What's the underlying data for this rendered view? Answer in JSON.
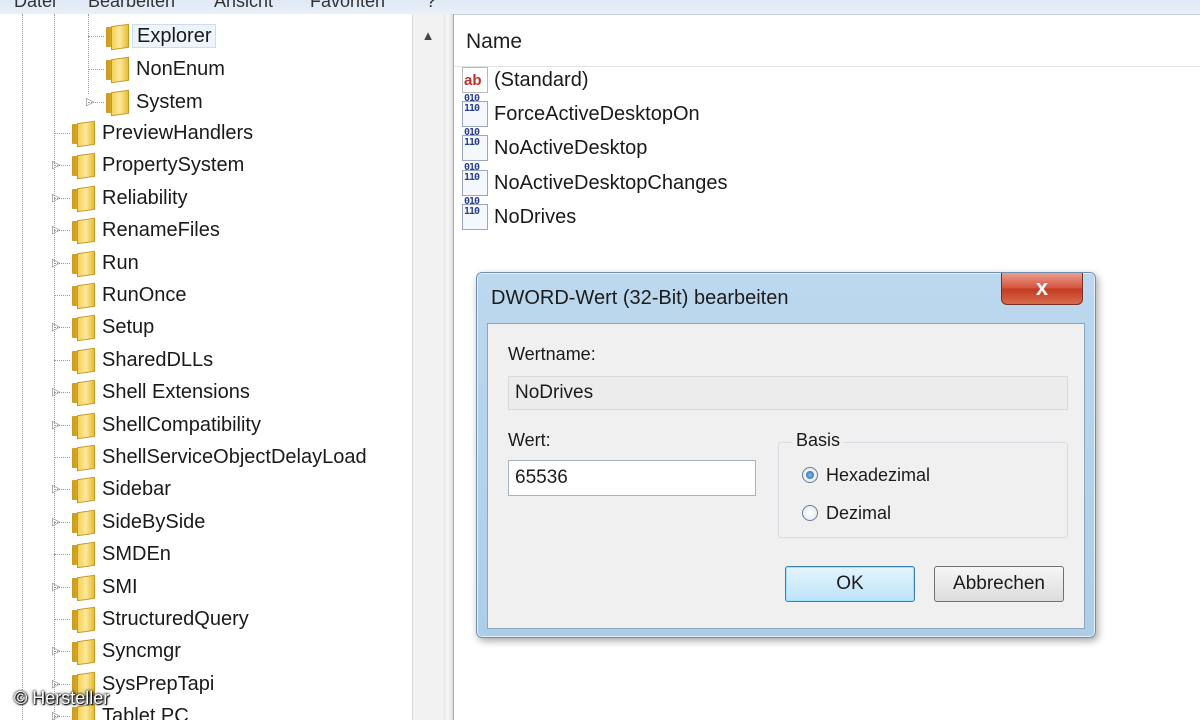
{
  "menubar": {
    "items": [
      "Datei",
      "Bearbeiten",
      "Ansicht",
      "Favoriten",
      "?"
    ]
  },
  "tree": {
    "child_items": [
      {
        "label": "Explorer",
        "selected": true,
        "expandable": false
      },
      {
        "label": "NonEnum",
        "expandable": false
      },
      {
        "label": "System",
        "expandable": true
      }
    ],
    "items": [
      {
        "label": "PreviewHandlers",
        "expandable": false
      },
      {
        "label": "PropertySystem",
        "expandable": true
      },
      {
        "label": "Reliability",
        "expandable": true
      },
      {
        "label": "RenameFiles",
        "expandable": true
      },
      {
        "label": "Run",
        "expandable": true
      },
      {
        "label": "RunOnce",
        "expandable": false
      },
      {
        "label": "Setup",
        "expandable": true
      },
      {
        "label": "SharedDLLs",
        "expandable": false
      },
      {
        "label": "Shell Extensions",
        "expandable": true
      },
      {
        "label": "ShellCompatibility",
        "expandable": true
      },
      {
        "label": "ShellServiceObjectDelayLoad",
        "expandable": false
      },
      {
        "label": "Sidebar",
        "expandable": true
      },
      {
        "label": "SideBySide",
        "expandable": true
      },
      {
        "label": "SMDEn",
        "expandable": false
      },
      {
        "label": "SMI",
        "expandable": true
      },
      {
        "label": "StructuredQuery",
        "expandable": false
      },
      {
        "label": "Syncmgr",
        "expandable": true
      },
      {
        "label": "SysPrepTapi",
        "expandable": true
      },
      {
        "label": "Tablet PC",
        "expandable": true
      }
    ]
  },
  "list": {
    "column_name": "Name",
    "values": [
      {
        "name": "(Standard)",
        "type": "string-icon"
      },
      {
        "name": "ForceActiveDesktopOn",
        "type": "binary-icon"
      },
      {
        "name": "NoActiveDesktop",
        "type": "binary-icon"
      },
      {
        "name": "NoActiveDesktopChanges",
        "type": "binary-icon"
      },
      {
        "name": "NoDrives",
        "type": "binary-icon"
      }
    ]
  },
  "dialog": {
    "title": "DWORD-Wert (32-Bit) bearbeiten",
    "close_label": "x",
    "value_name_label": "Wertname:",
    "value_name": "NoDrives",
    "value_data_label": "Wert:",
    "value_data": "65536",
    "base_label": "Basis",
    "base_options": [
      {
        "label": "Hexadezimal",
        "checked": true
      },
      {
        "label": "Dezimal",
        "checked": false
      }
    ],
    "ok_label": "OK",
    "cancel_label": "Abbrechen"
  },
  "credit": "© Hersteller"
}
